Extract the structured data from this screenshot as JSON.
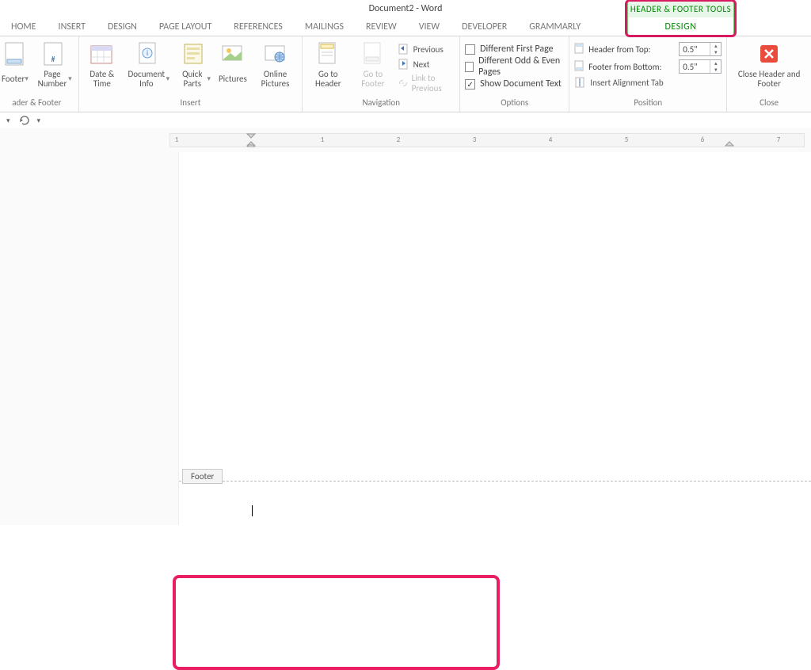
{
  "title": "Document2 - Word",
  "tooltab_title": "HEADER & FOOTER TOOLS",
  "tabs": [
    "HOME",
    "INSERT",
    "DESIGN",
    "PAGE LAYOUT",
    "REFERENCES",
    "MAILINGS",
    "REVIEW",
    "VIEW",
    "DEVELOPER",
    "GRAMMARLY"
  ],
  "design_tab": "DESIGN",
  "group_labels": {
    "hf": "ader & Footer",
    "insert": "Insert",
    "nav": "Navigation",
    "options": "Options",
    "position": "Position",
    "close": "Close"
  },
  "btn": {
    "footer": "Footer",
    "page_number": "Page Number",
    "date_time": "Date & Time",
    "doc_info": "Document Info",
    "quick_parts": "Quick Parts",
    "pictures": "Pictures",
    "online_pictures": "Online Pictures",
    "goto_header": "Go to Header",
    "goto_footer": "Go to Footer",
    "previous": "Previous",
    "next": "Next",
    "link_prev": "Link to Previous",
    "diff_first": "Different First Page",
    "diff_odd": "Different Odd & Even Pages",
    "show_doc": "Show Document Text",
    "header_from_top": "Header from Top:",
    "footer_from_bottom": "Footer from Bottom:",
    "insert_align_tab": "Insert Alignment Tab",
    "close_hf": "Close Header and Footer"
  },
  "values": {
    "header_from_top": "0.5\"",
    "footer_from_bottom": "0.5\""
  },
  "checks": {
    "diff_first": false,
    "diff_odd": false,
    "show_doc": true
  },
  "ruler_numbers": [
    "1",
    "1",
    "2",
    "3",
    "4",
    "5",
    "6",
    "7"
  ],
  "footer_label": "Footer"
}
